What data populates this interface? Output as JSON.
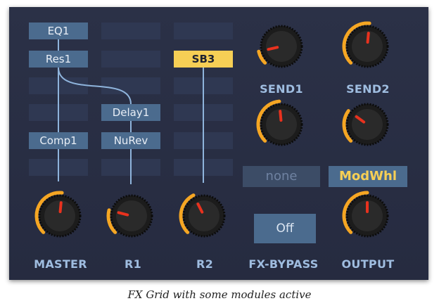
{
  "grid": {
    "col1": [
      "EQ1",
      "Res1",
      "",
      "",
      "Comp1",
      ""
    ],
    "col2": [
      "",
      "",
      "",
      "Delay1",
      "NuRev",
      ""
    ],
    "col3": [
      "",
      "SB3",
      "",
      "",
      "",
      ""
    ]
  },
  "knobs": {
    "send1": {
      "label": "SEND1",
      "value": 0.12
    },
    "send2": {
      "label": "SEND2",
      "value": 0.52
    },
    "mod_amount": {
      "value": 0.48
    },
    "mod_amount2": {
      "value": 0.3
    },
    "master": {
      "label": "MASTER",
      "value": 0.52
    },
    "r1": {
      "label": "R1",
      "value": 0.22
    },
    "r2": {
      "label": "R2",
      "value": 0.4
    },
    "output": {
      "label": "OUTPUT",
      "value": 0.5
    }
  },
  "mod_source_left": "none",
  "mod_source_right": "ModWhl",
  "bypass": {
    "button_label": "Off",
    "label": "FX-BYPASS"
  },
  "caption": "FX Grid with some modules active",
  "colors": {
    "accent": "#f5a623",
    "highlight": "#f6cf55",
    "label": "#9fbde0",
    "slot_filled": "#4b6b8e",
    "slot_empty": "#2f3852"
  }
}
